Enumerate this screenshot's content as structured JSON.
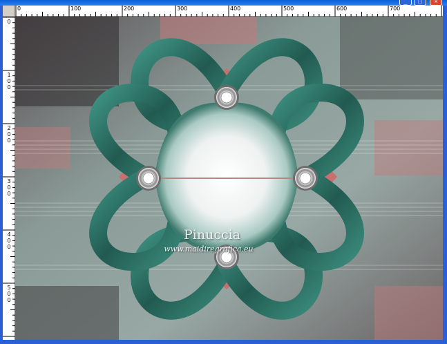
{
  "window": {
    "title": "",
    "buttons": {
      "minimize": "_",
      "maximize": "□",
      "close": "×"
    }
  },
  "ruler_horizontal": {
    "labels": [
      "0",
      "100",
      "200",
      "300",
      "400",
      "500",
      "600",
      "700"
    ]
  },
  "ruler_vertical": {
    "labels": [
      "0",
      "100",
      "200",
      "300",
      "400",
      "500"
    ]
  },
  "artwork": {
    "signature": "Pinuccia",
    "url": "www.maidiregrafica.eu",
    "colors": {
      "ribbon": "#2f7a6c",
      "ribbon_dark": "#1d4f47",
      "pink": "#c77a78",
      "center": "#f4f6f5",
      "background": "#8a9a96"
    }
  }
}
